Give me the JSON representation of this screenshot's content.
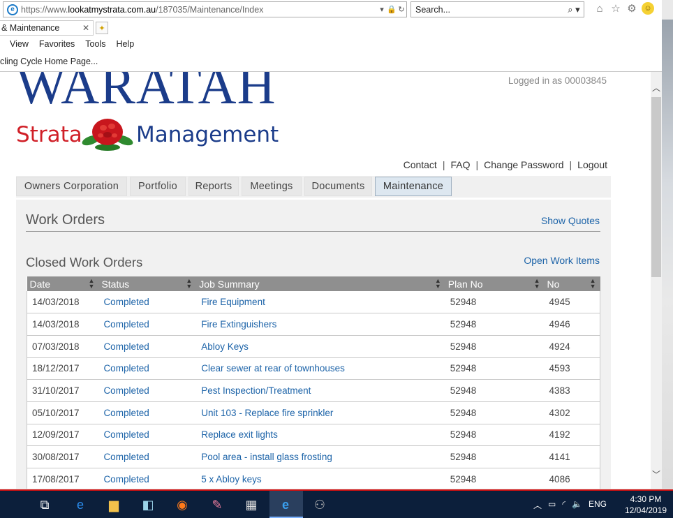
{
  "browser": {
    "url_prefix": "https://www.",
    "url_host": "lookatmystrata.com.au",
    "url_path": "/187035/Maintenance/Index",
    "search_placeholder": "Search...",
    "tab_title": "& Maintenance",
    "menu": [
      "View",
      "Favorites",
      "Tools",
      "Help"
    ],
    "favorites_item": "cling Cycle Home Page..."
  },
  "site": {
    "logo_line1": "WARATAH",
    "logo_strata": "Strata",
    "logo_management": "Management",
    "logged_in": "Logged in as 00003845",
    "links": [
      "Contact",
      "FAQ",
      "Change Password",
      "Logout"
    ],
    "nav_tabs": [
      "Owners Corporation",
      "Portfolio",
      "Reports",
      "Meetings",
      "Documents",
      "Maintenance"
    ],
    "active_tab": "Maintenance"
  },
  "work_orders": {
    "heading": "Work Orders",
    "show_quotes": "Show Quotes",
    "closed_heading": "Closed Work Orders",
    "open_items": "Open Work Items",
    "columns": [
      "Date",
      "Status",
      "Job Summary",
      "Plan No",
      "No"
    ],
    "rows": [
      {
        "date": "14/03/2018",
        "status": "Completed",
        "summary": "Fire Equipment",
        "plan": "52948",
        "no": "4945"
      },
      {
        "date": "14/03/2018",
        "status": "Completed",
        "summary": "Fire Extinguishers",
        "plan": "52948",
        "no": "4946"
      },
      {
        "date": "07/03/2018",
        "status": "Completed",
        "summary": "Abloy Keys",
        "plan": "52948",
        "no": "4924"
      },
      {
        "date": "18/12/2017",
        "status": "Completed",
        "summary": "Clear sewer at rear of townhouses",
        "plan": "52948",
        "no": "4593"
      },
      {
        "date": "31/10/2017",
        "status": "Completed",
        "summary": "Pest Inspection/Treatment",
        "plan": "52948",
        "no": "4383"
      },
      {
        "date": "05/10/2017",
        "status": "Completed",
        "summary": "Unit 103 - Replace fire sprinkler",
        "plan": "52948",
        "no": "4302"
      },
      {
        "date": "12/09/2017",
        "status": "Completed",
        "summary": "Replace exit lights",
        "plan": "52948",
        "no": "4192"
      },
      {
        "date": "30/08/2017",
        "status": "Completed",
        "summary": "Pool area - install glass frosting",
        "plan": "52948",
        "no": "4141"
      },
      {
        "date": "17/08/2017",
        "status": "Completed",
        "summary": "5 x Abloy keys",
        "plan": "52948",
        "no": "4086"
      }
    ]
  },
  "taskbar": {
    "language": "ENG",
    "time": "4:30 PM",
    "date": "12/04/2019"
  }
}
